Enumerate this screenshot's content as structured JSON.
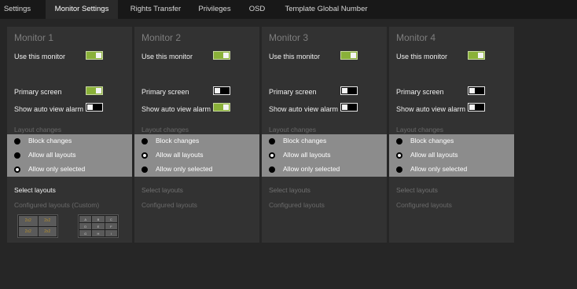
{
  "tabs": [
    "Settings",
    "Monitor Settings",
    "Rights Transfer",
    "Privileges",
    "OSD",
    "Template Global Number"
  ],
  "active_tab": "Monitor Settings",
  "labels": {
    "use_monitor": "Use this monitor",
    "primary_screen": "Primary screen",
    "auto_view_alarm": "Show auto view alarm",
    "layout_changes": "Layout changes",
    "block_changes": "Block changes",
    "allow_all": "Allow all layouts",
    "allow_selected": "Allow only selected",
    "select_layouts": "Select layouts",
    "configured_layouts": "Configured layouts",
    "configured_layouts_custom": "Configured layouts (Custom)"
  },
  "monitors": [
    {
      "title": "Monitor 1",
      "use": "on",
      "primary": "on",
      "alarm": "off",
      "layout_choice": "Allow only selected"
    },
    {
      "title": "Monitor 2",
      "use": "on",
      "primary": "off",
      "alarm": "on",
      "layout_choice": "Allow all layouts"
    },
    {
      "title": "Monitor 3",
      "use": "on",
      "primary": "off",
      "alarm": "off",
      "layout_choice": "Allow all layouts"
    },
    {
      "title": "Monitor 4",
      "use": "on",
      "primary": "off",
      "alarm": "off",
      "layout_choice": "Allow all layouts"
    }
  ],
  "layout_thumbs": {
    "quad_cells": [
      "2x2",
      "2x2",
      "2x2",
      "2x2"
    ],
    "grid_cells": [
      "A",
      "B",
      "C",
      "D",
      "E",
      "F",
      "G",
      "H",
      "I"
    ]
  },
  "colors": {
    "toggle_on": "#8ab139",
    "radio_band": "#8c8c8c",
    "panel": "#323232",
    "background": "#262626"
  }
}
